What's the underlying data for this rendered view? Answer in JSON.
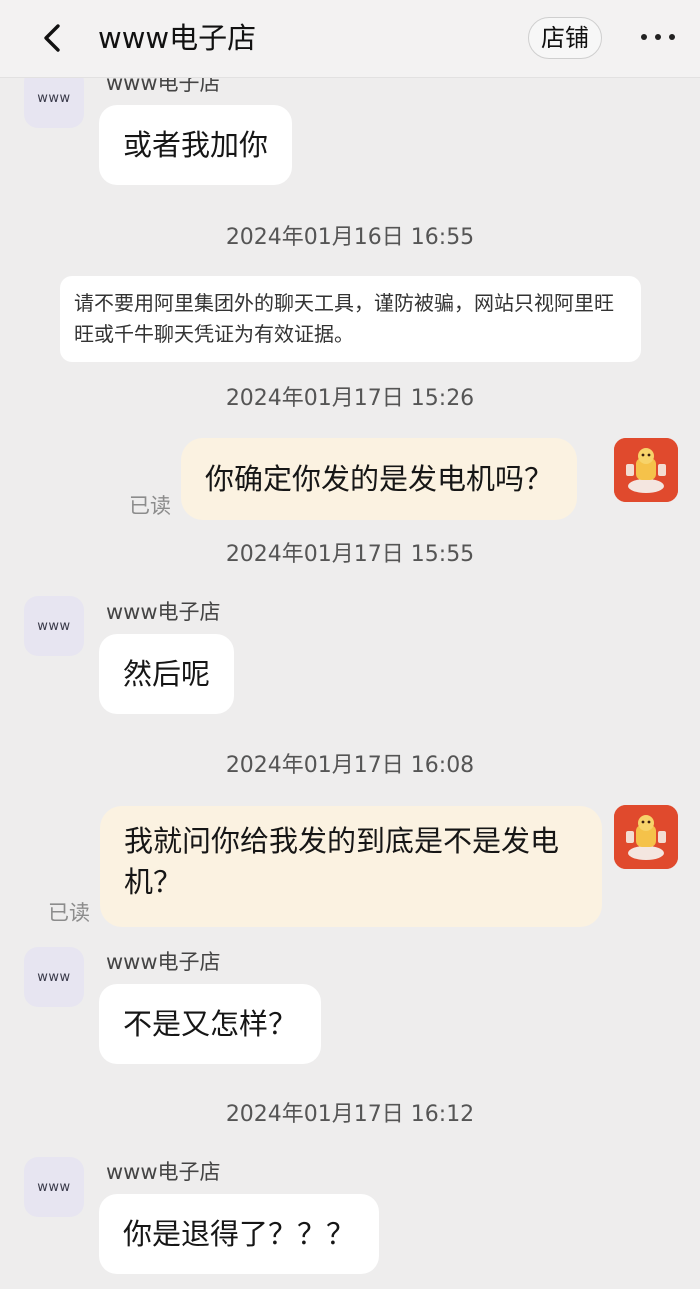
{
  "header": {
    "title": "www电子店",
    "shop_button": "店铺",
    "back_icon": "chevron-left-icon",
    "more_icon": "more-dots-icon"
  },
  "avatar_text": "www",
  "messages": [
    {
      "type": "incoming",
      "sender": "www电子店",
      "text": "或者我加你"
    },
    {
      "type": "timestamp",
      "text": "2024年01月16日 16:55"
    },
    {
      "type": "notice",
      "text": "请不要用阿里集团外的聊天工具，谨防被骗，网站只视阿里旺旺或千牛聊天凭证为有效证据。"
    },
    {
      "type": "timestamp",
      "text": "2024年01月17日 15:26"
    },
    {
      "type": "outgoing",
      "text": "你确定你发的是发电机吗？",
      "status": "已读"
    },
    {
      "type": "timestamp",
      "text": "2024年01月17日 15:55"
    },
    {
      "type": "incoming",
      "sender": "www电子店",
      "text": "然后呢"
    },
    {
      "type": "timestamp",
      "text": "2024年01月17日 16:08"
    },
    {
      "type": "outgoing",
      "text": "我就问你给我发的到底是不是发电机？",
      "status": "已读"
    },
    {
      "type": "incoming",
      "sender": "www电子店",
      "text": "不是又怎样？"
    },
    {
      "type": "timestamp",
      "text": "2024年01月17日 16:12"
    },
    {
      "type": "incoming",
      "sender": "www电子店",
      "text": "你是退得了？？？"
    }
  ],
  "colors": {
    "background": "#eeeded",
    "incoming_bubble": "#ffffff",
    "outgoing_bubble": "#fbf2e1",
    "user_avatar": "#e04a2d",
    "shop_avatar": "#e7e5f1"
  }
}
